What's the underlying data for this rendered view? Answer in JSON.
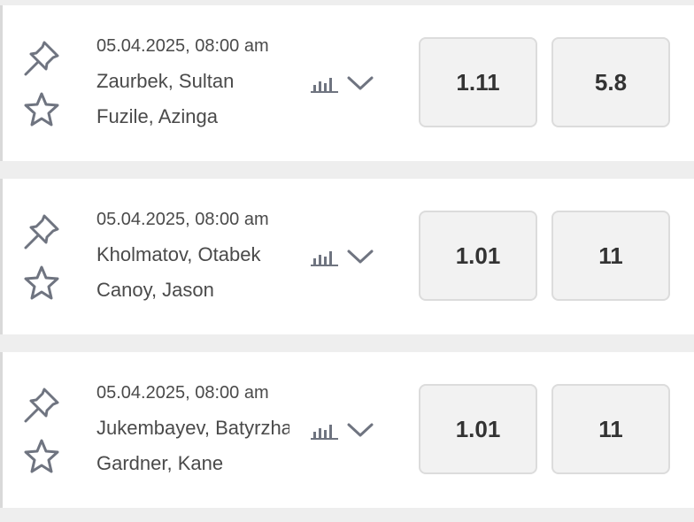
{
  "icons": {
    "pin": "pin-icon",
    "star": "star-icon",
    "stats": "bar-chart-icon",
    "expand": "chevron-down-icon"
  },
  "colors": {
    "icon_gray": "#6f7480",
    "odds_bg": "#f2f2f2",
    "separator": "#eeeeee"
  },
  "matches": [
    {
      "datetime": "05.04.2025, 08:00 am",
      "player1": "Zaurbek, Sultan",
      "player2": "Fuzile, Azinga",
      "odd1": "1.11",
      "odd2": "5.8"
    },
    {
      "datetime": "05.04.2025, 08:00 am",
      "player1": "Kholmatov, Otabek",
      "player2": "Canoy, Jason",
      "odd1": "1.01",
      "odd2": "11"
    },
    {
      "datetime": "05.04.2025, 08:00 am",
      "player1": "Jukembayev, Batyrzhan",
      "player2": "Gardner, Kane",
      "odd1": "1.01",
      "odd2": "11"
    }
  ]
}
